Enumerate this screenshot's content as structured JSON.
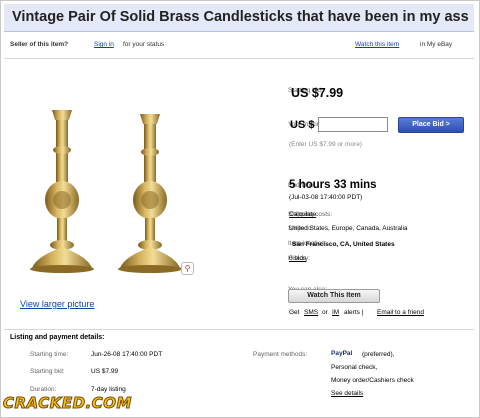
{
  "listing": {
    "title": "Vintage Pair Of Solid Brass Candlesticks that have been in my ass"
  },
  "seller_bar": {
    "prefix": "Seller of this item?",
    "sign_in": "Sign in",
    "suffix": "for your status",
    "watch_link": "Watch this item",
    "watch_suffix": "in My eBay"
  },
  "bid": {
    "starting_bid_label": "Starting bid:",
    "starting_bid_value": "US $7.99",
    "max_bid_label": "Your maximum bid:",
    "max_bid_currency": "US $",
    "max_bid_value": "",
    "place_bid_label": "Place Bid >",
    "enter_hint": "(Enter US $7.99 or more)"
  },
  "info": {
    "end_time_label": "End time:",
    "end_time_value": "5 hours 33 mins",
    "end_time_detail": "(Jul-03-08 17:40:00 PDT)",
    "shipping_label": "Shipping costs:",
    "shipping_value": "Calculate",
    "ships_to_label": "Ships to:",
    "ships_to_value": "United States, Europe, Canada, Australia",
    "location_label": "Item location:",
    "location_value": "San Francisco, CA, United States",
    "history_label": "History:",
    "history_value": "0 bids"
  },
  "media": {
    "view_larger": "View larger picture",
    "zoom_icon": "magnifier-icon"
  },
  "also": {
    "label": "You can also:",
    "watch_button": "Watch This Item",
    "get": "Get",
    "sms": "SMS",
    "or": "or",
    "im": "IM",
    "alerts": "alerts |",
    "email": "Email to a friend"
  },
  "details": {
    "heading": "Listing and payment details:",
    "start_time_label": "Starting time:",
    "start_time_value": "Jun-26-08 17:40:00 PDT",
    "start_bid_label": "Starting bid:",
    "start_bid_value": "US $7.99",
    "duration_label": "Duration:",
    "duration_value": "7-day listing",
    "payment_label": "Payment methods:",
    "paypal": "PayPal",
    "paypal_note": "(preferred),",
    "payment_line2": "Personal check,",
    "payment_line3": "Money order/Cashiers check",
    "see_details": "See details"
  },
  "watermark": {
    "text": "CRACKED.COM"
  },
  "colors": {
    "title_bar": "#e4e8f7",
    "link": "#1a3ea8",
    "place_bid": "#3a5bc0",
    "watermark": "#f4c21a"
  }
}
